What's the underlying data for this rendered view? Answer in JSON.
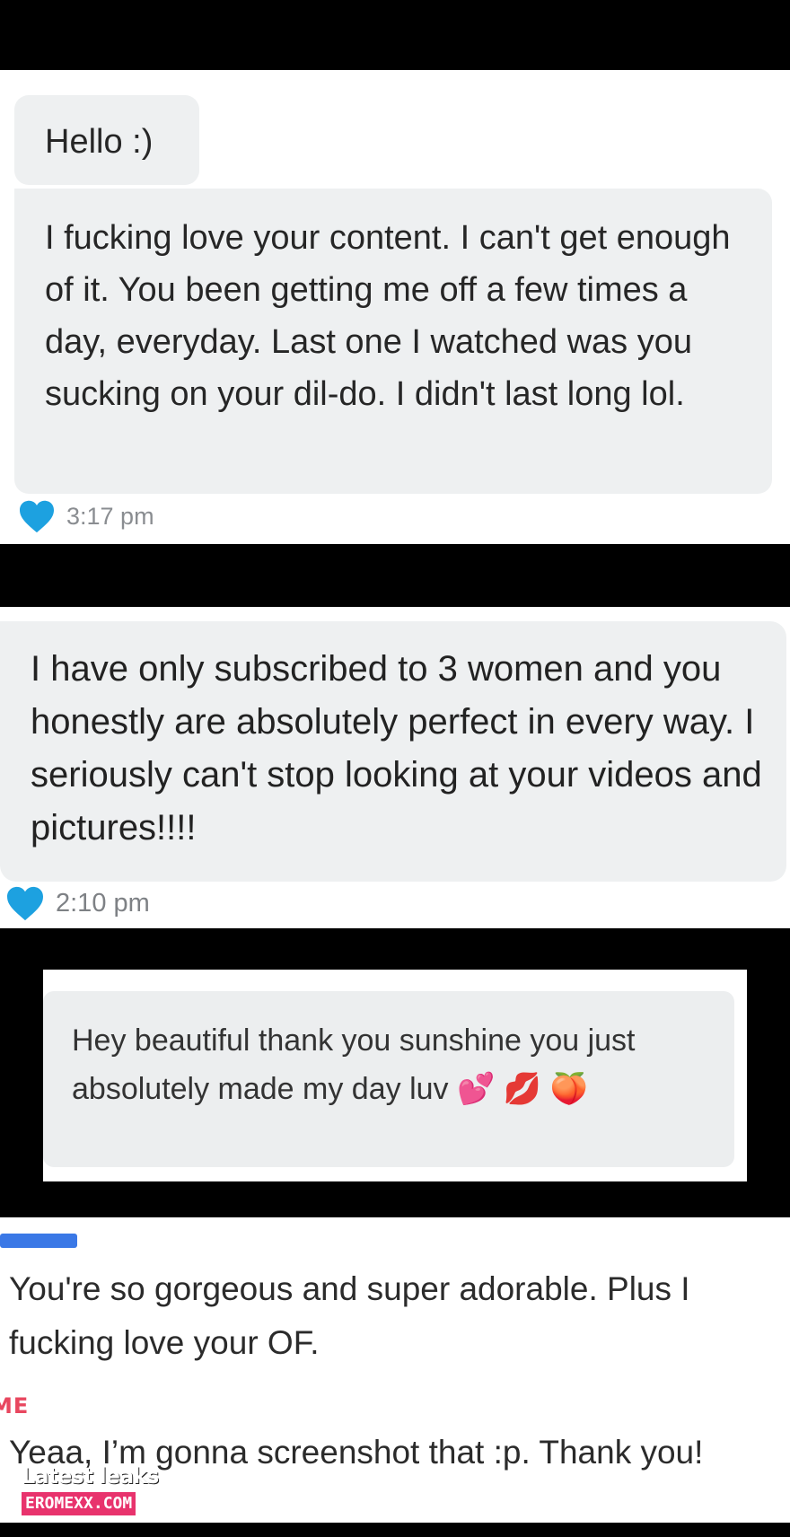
{
  "panel1": {
    "greeting": "Hello :)",
    "message": "I fucking love your content. I can't get enough of it. You been getting me off a few times a day, everyday. Last one I watched was you sucking on your dil-do. I didn't last long lol.",
    "time": "3:17 pm",
    "heart_icon": "heart-icon",
    "heart_color": "#1da1e0"
  },
  "panel2": {
    "message": "I have only subscribed to 3 women and you honestly are absolutely perfect in every way. I seriously can't stop looking at your videos and pictures!!!!",
    "time": "2:10 pm",
    "heart_icon": "heart-icon",
    "heart_color": "#1da1e0"
  },
  "panel3": {
    "message": "Hey beautiful thank you sunshine you just absolutely made my day luv",
    "emoji": "💕 💋 🍑"
  },
  "panel4": {
    "incoming": "You're so gorgeous and super adorable. Plus I fucking love your OF.",
    "me_label": "ME",
    "reply": "Yeaa, I’m gonna screenshot that :p. Thank you!",
    "sender_color": "#3a78e6",
    "me_color": "#e8475f"
  },
  "watermark": {
    "title": "Latest leaks",
    "site": "EROMEXX.COM"
  }
}
